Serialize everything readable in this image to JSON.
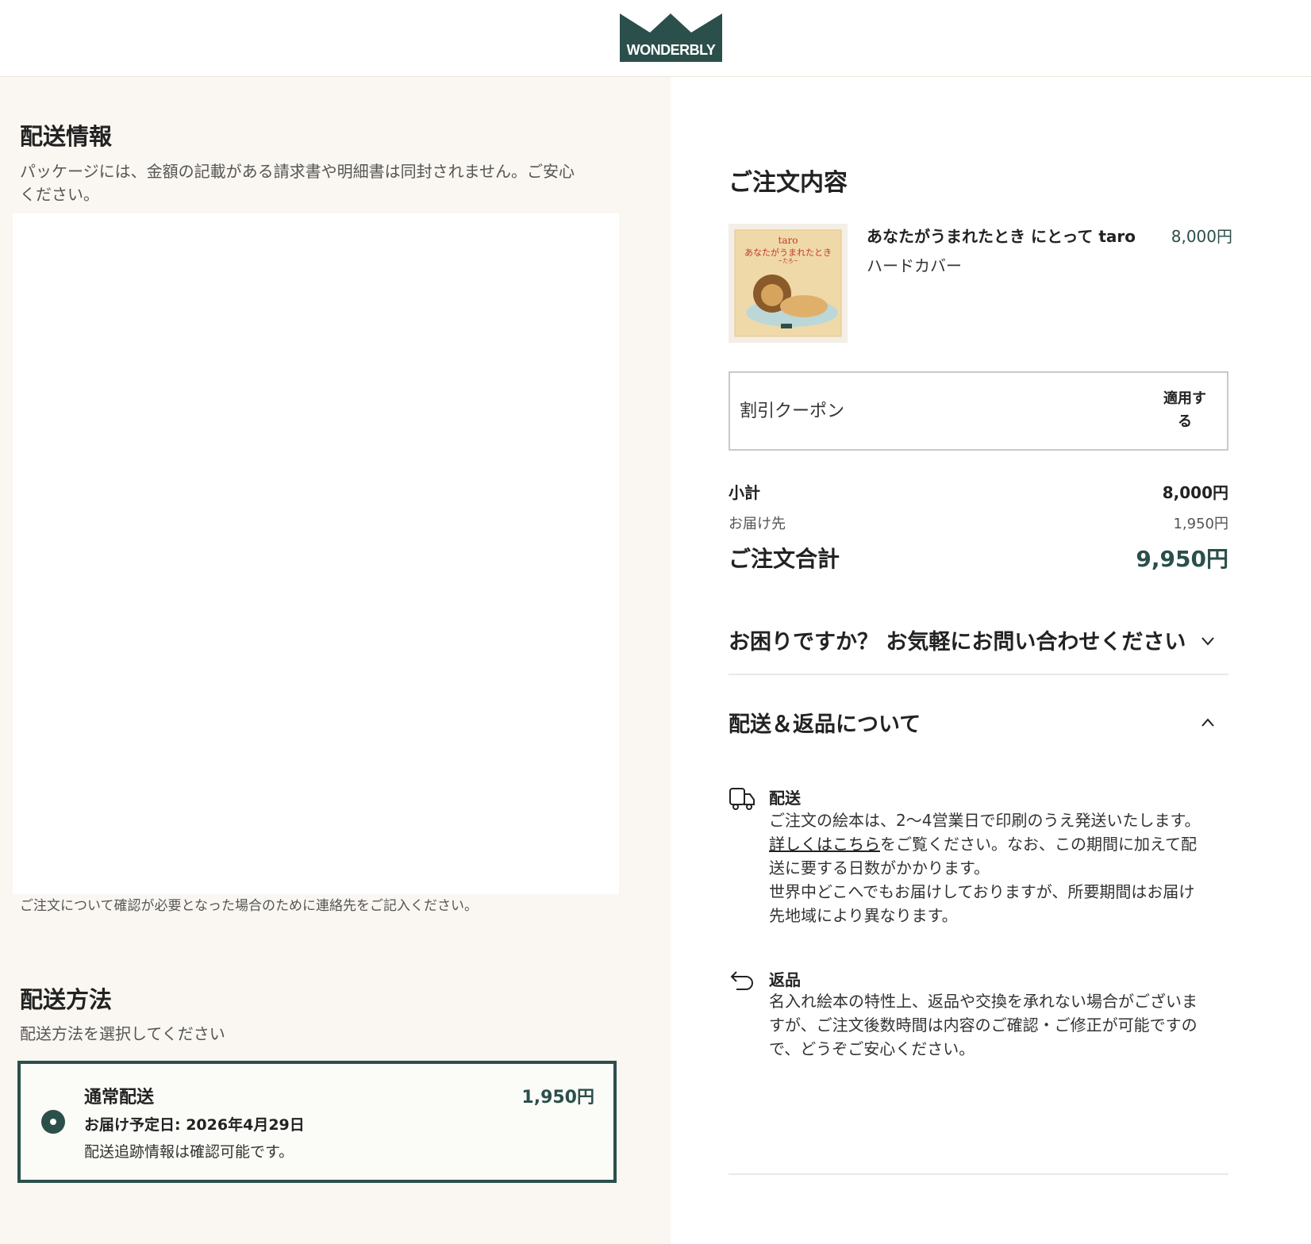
{
  "brand": {
    "logo_text": "WONDERBLY",
    "color": "#2b4f4a"
  },
  "shipping_info": {
    "title": "配送情報",
    "note_line1": "パッケージには、金額の記載がある請求書や明細書は同封されません。ご安心",
    "note_line2": "ください。",
    "contact_note": "ご注文について確認が必要となった場合のために連絡先をご記入ください。"
  },
  "shipping_method": {
    "title": "配送方法",
    "subtitle": "配送方法を選択してください",
    "option": {
      "name": "通常配送",
      "price": "1,950円",
      "delivery_date": "お届け予定日: 2026年4月29日",
      "tracking": "配送追跡情報は確認可能です。",
      "selected": true
    }
  },
  "order": {
    "title": "ご注文内容",
    "item": {
      "name": "あなたがうまれたとき にとって taro",
      "format": "ハードカバー",
      "price": "8,000円",
      "cover_name": "taro",
      "cover_title": "あなたがうまれたとき",
      "cover_sub": "~たろ~"
    },
    "coupon": {
      "placeholder": "割引クーポン",
      "apply_label_1": "適用す",
      "apply_label_2": "る"
    },
    "subtotal": {
      "label": "小計",
      "value": "8,000円"
    },
    "shipping": {
      "label": "お届け先",
      "value": "1,950円"
    },
    "total": {
      "label": "ご注文合計",
      "value": "9,950円"
    }
  },
  "help": {
    "title": "お困りですか？ お気軽にお問い合わせください",
    "expanded": false
  },
  "policy": {
    "title": "配送＆返品について",
    "expanded": true,
    "delivery": {
      "title": "配送",
      "line1": "ご注文の絵本は、2〜4営業日で印刷のうえ発送いたします。",
      "link": "詳しくはこちら",
      "line2_rest": "をご覧ください。なお、この期間に加えて配",
      "line3": "送に要する日数がかかります。",
      "line4": "世界中どこへでもお届けしておりますが、所要期間はお届け",
      "line5": "先地域により異なります。"
    },
    "returns": {
      "title": "返品",
      "line1": "名入れ絵本の特性上、返品や交換を承れない場合がございま",
      "line2": "すが、ご注文後数時間は内容のご確認・ご修正が可能ですの",
      "line3": "で、どうぞご安心ください。"
    }
  }
}
